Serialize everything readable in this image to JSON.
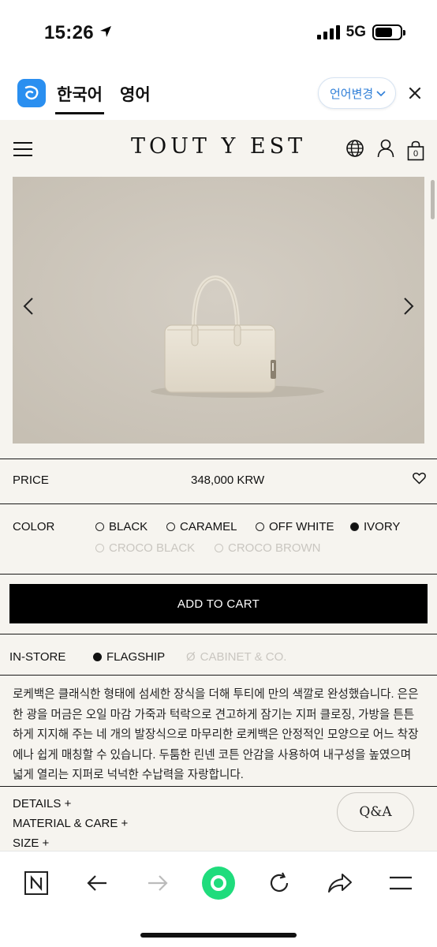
{
  "status": {
    "time": "15:26",
    "network": "5G"
  },
  "translator": {
    "tab_korean": "한국어",
    "tab_english": "영어",
    "change_language": "언어변경"
  },
  "site": {
    "brand": "TOUT Y EST",
    "cart_count": "0",
    "price": {
      "label": "PRICE",
      "value": "348,000 KRW"
    },
    "color": {
      "label": "COLOR",
      "options": [
        {
          "label": "BLACK",
          "selected": false,
          "available": true
        },
        {
          "label": "CARAMEL",
          "selected": false,
          "available": true
        },
        {
          "label": "OFF WHITE",
          "selected": false,
          "available": true
        },
        {
          "label": "IVORY",
          "selected": true,
          "available": true
        },
        {
          "label": "CROCO BLACK",
          "selected": false,
          "available": false
        },
        {
          "label": "CROCO BROWN",
          "selected": false,
          "available": false
        }
      ]
    },
    "add_to_cart": "ADD TO CART",
    "in_store": {
      "label": "IN-STORE",
      "stores": [
        {
          "label": "FLAGSHIP",
          "available": true
        },
        {
          "label": "CABINET & CO.",
          "available": false
        }
      ]
    },
    "description_lines": [
      "로케백은 클래식한 형태에 섬세한 장식을 더해 투티에 만의 색깔로 완성했습니다. 은은",
      "한 광을 머금은 오일 마감 가죽과 턱락으로 견고하게 잠기는 지퍼 클로징, 가방을 튼튼",
      "하게 지지해 주는 네 개의 발장식으로 마무리한 로케백은 안정적인 모양으로 어느 착장",
      "에나 쉽게 매칭할 수 있습니다. 두툼한 린넨 코튼 안감을 사용하여 내구성을 높였으며",
      "넓게 열리는 지퍼로 넉넉한 수납력을 자랑합니다."
    ],
    "details": "DETAILS +",
    "material_care": "MATERIAL & CARE +",
    "size": "SIZE +",
    "qa": "Q&A"
  },
  "colors": {
    "accent_blue": "#2f7fd8",
    "cta_black": "#000000",
    "site_bg": "#f6f4ef",
    "nav_green": "#1fdc7c"
  }
}
